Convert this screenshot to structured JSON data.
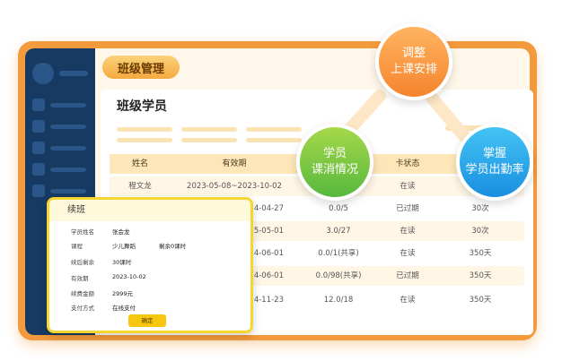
{
  "header": {
    "title": "班级管理"
  },
  "card": {
    "title": "班级学员"
  },
  "table": {
    "headers": [
      "姓名",
      "有效期",
      "",
      "卡状态",
      ""
    ],
    "rows": [
      [
        "程文龙",
        "2023-05-08~2023-10-02",
        "",
        "在读",
        ""
      ],
      [
        "",
        "4-04-27",
        "0.0/5",
        "已过期",
        "30次"
      ],
      [
        "",
        "5-05-01",
        "3.0/27",
        "在读",
        "30次"
      ],
      [
        "",
        "4-06-01",
        "0.0/1(共享)",
        "在读",
        "350天"
      ],
      [
        "",
        "4-06-01",
        "0.0/98(共享)",
        "已过期",
        "350天"
      ],
      [
        "",
        "4-11-23",
        "12.0/18",
        "在读",
        "350天"
      ]
    ]
  },
  "bubbles": {
    "orange": [
      "调整",
      "上课安排"
    ],
    "green": [
      "学员",
      "课消情况"
    ],
    "blue": [
      "掌握",
      "学员出勤率"
    ]
  },
  "popup": {
    "title": "续班",
    "fields": [
      {
        "label": "学员姓名",
        "value": "张会龙",
        "extra": ""
      },
      {
        "label": "课程",
        "value": "少儿舞蹈",
        "extra": "剩余0课时"
      },
      {
        "label": "续后剩余",
        "value": "30课时",
        "extra": ""
      },
      {
        "label": "有效期",
        "value": "2023-10-02",
        "extra": ""
      },
      {
        "label": "续费金额",
        "value": "2999元",
        "extra": ""
      },
      {
        "label": "支付方式",
        "value": "在线支付",
        "extra": ""
      }
    ],
    "confirm_label": "确定"
  },
  "colors": {
    "frame": "#f39a3c",
    "sidebar": "#163a62",
    "table_header": "#fde7b8",
    "popup_border": "#f7d531",
    "bubble_orange": "#f5842e",
    "bubble_green": "#57b83e",
    "bubble_blue": "#1a8fe0"
  }
}
